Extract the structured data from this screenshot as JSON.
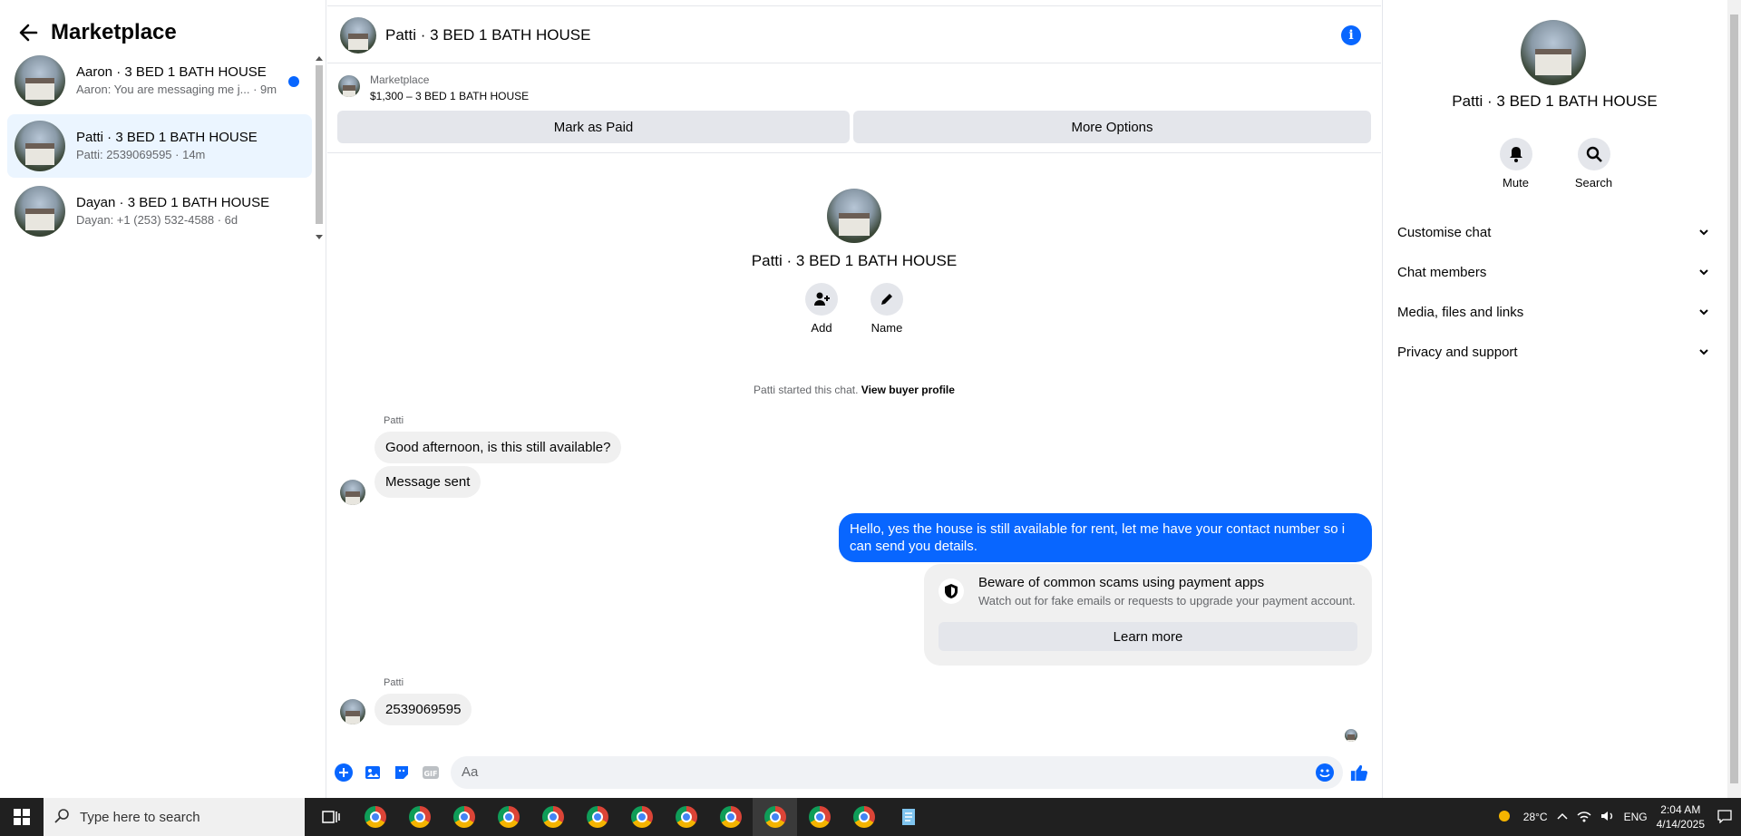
{
  "sidebar": {
    "title": "Marketplace",
    "conversations": [
      {
        "name": "Aaron · 3 BED 1 BATH HOUSE",
        "preview": "Aaron: You are messaging me j... · 9m",
        "unread": true
      },
      {
        "name": "Patti · 3 BED 1 BATH HOUSE",
        "preview": "Patti: 2539069595 · 14m",
        "active": true
      },
      {
        "name": "Dayan · 3 BED 1 BATH HOUSE",
        "preview": "Dayan: +1 (253) 532-4588 · 6d"
      }
    ]
  },
  "chat": {
    "title": "Patti · 3 BED 1 BATH HOUSE",
    "marketplace_label": "Marketplace",
    "listing": "$1,300 – 3 BED 1 BATH HOUSE",
    "mark_paid": "Mark as Paid",
    "more_options": "More Options",
    "intro_name": "Patti · 3 BED 1 BATH HOUSE",
    "add_label": "Add",
    "name_label": "Name",
    "started_text": "Patti started this chat.",
    "view_profile": "View buyer profile",
    "sender1": "Patti",
    "msg1": "Good afternoon, is this still available?",
    "msg2": "Message sent",
    "msg_out": "Hello, yes the house is still available for rent, let me have your contact number so i can send you details.",
    "scam_title": "Beware of common scams using payment apps",
    "scam_sub": "Watch out for fake emails or requests to upgrade your payment account.",
    "learn_more": "Learn more",
    "sender2": "Patti",
    "msg3": "2539069595",
    "input_placeholder": "Aa"
  },
  "right_panel": {
    "name": "Patti · 3 BED 1 BATH HOUSE",
    "mute": "Mute",
    "search": "Search",
    "sections": [
      "Customise chat",
      "Chat members",
      "Media, files and links",
      "Privacy and support"
    ]
  },
  "taskbar": {
    "search_placeholder": "Type here to search",
    "weather": "28°C",
    "lang": "ENG",
    "time": "2:04 AM",
    "date": "4/14/2025"
  },
  "colors": {
    "accent": "#0866ff",
    "bubble": "#f0f0f0",
    "button": "#e4e6eb"
  }
}
